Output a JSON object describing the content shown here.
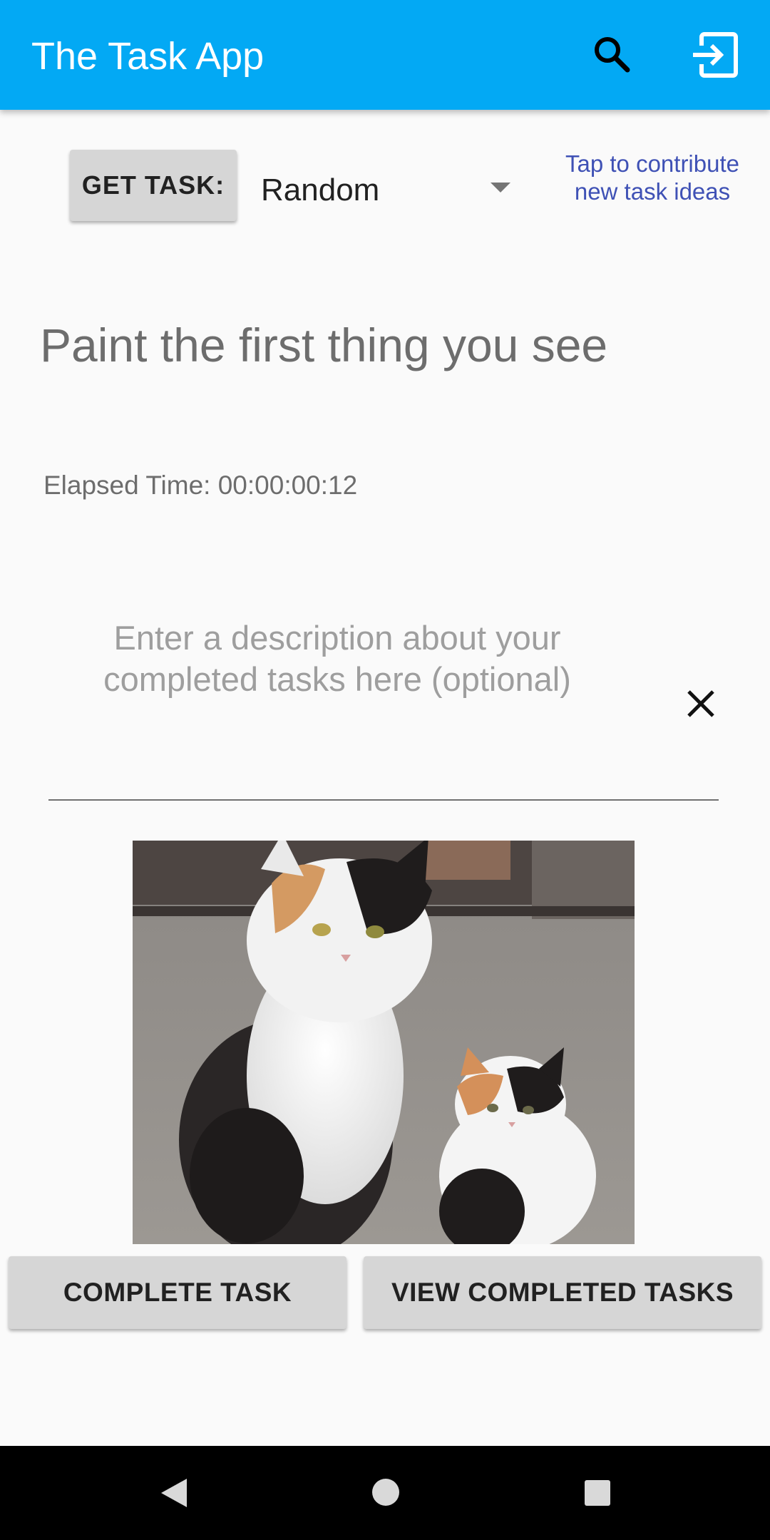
{
  "app_bar": {
    "title": "The Task App",
    "background_color": "#03a9f4",
    "icons": [
      "search-icon",
      "exit-to-app-icon"
    ]
  },
  "task_selector": {
    "get_task_label": "GET TASK:",
    "spinner_value": "Random",
    "contribute_link": "Tap to contribute new task ideas"
  },
  "task": {
    "text": "Paint the first thing you see",
    "elapsed_time": "Elapsed Time: 00:00:00:12"
  },
  "description": {
    "placeholder": "Enter a description about your completed tasks here (optional)",
    "value": ""
  },
  "photo": {
    "subject": "calico cat with calico kitten"
  },
  "actions": {
    "complete_label": "COMPLETE TASK",
    "view_completed_label": "VIEW COMPLETED TASKS"
  },
  "navigation": {
    "icons": [
      "back-icon",
      "home-icon",
      "recents-icon"
    ]
  },
  "colors": {
    "accent": "#03a9f4",
    "link": "#3f51b5",
    "button": "#d6d6d6"
  }
}
